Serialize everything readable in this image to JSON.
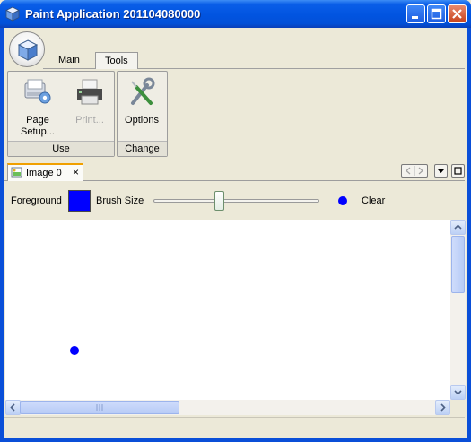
{
  "window": {
    "title": "Paint Application 201104080000",
    "controls": [
      "minimize-icon",
      "maximize-icon",
      "close-icon"
    ]
  },
  "ribbon": {
    "app_button_icon": "cube-icon",
    "tabs": [
      {
        "label": "Main",
        "active": false
      },
      {
        "label": "Tools",
        "active": true
      }
    ],
    "bands": [
      {
        "title": "Use",
        "buttons": [
          {
            "label_line1": "Page",
            "label_line2": "Setup...",
            "icon": "page-setup-icon",
            "enabled": true
          },
          {
            "label": "Print...",
            "icon": "printer-icon",
            "enabled": false
          }
        ]
      },
      {
        "title": "Change",
        "buttons": [
          {
            "label": "Options",
            "icon": "wrench-screwdriver-icon",
            "enabled": true
          }
        ]
      }
    ]
  },
  "document_tabs": [
    {
      "label": "Image 0",
      "icon": "image-icon",
      "close": "×"
    }
  ],
  "toolbar": {
    "foreground_label": "Foreground",
    "foreground_color": "#0000ff",
    "brush_size_label": "Brush Size",
    "brush_size_fraction": 0.39,
    "clear_label": "Clear"
  },
  "canvas": {
    "background": "#ffffff",
    "stroke_color": "#0000ff"
  },
  "scrollbars": {
    "vertical_position": 0.0,
    "horizontal_position": 0.0
  }
}
